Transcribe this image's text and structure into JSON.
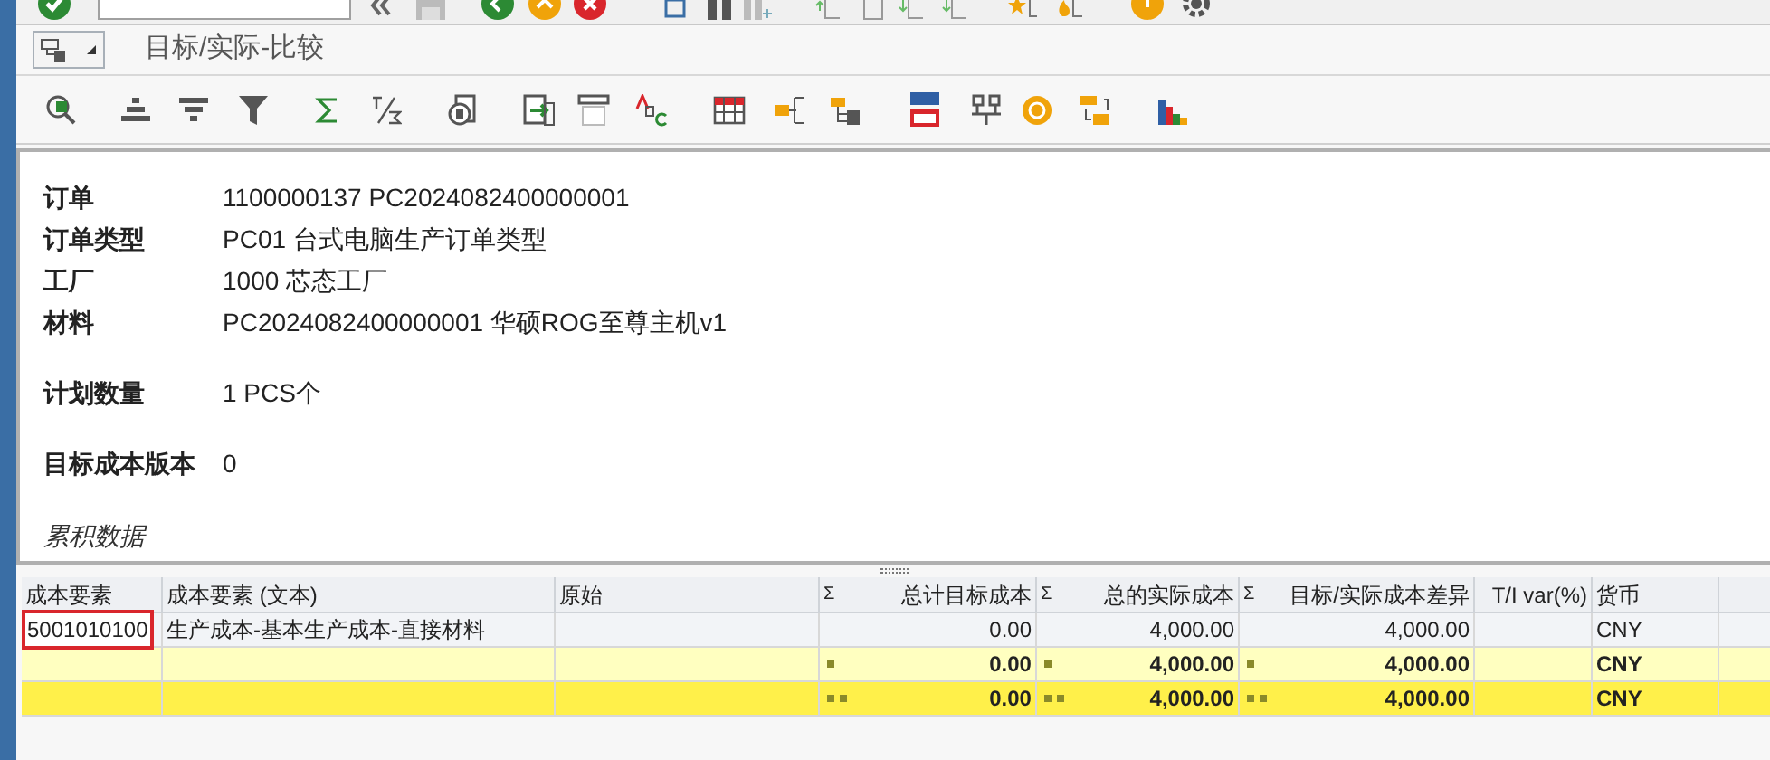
{
  "screen_title": "目标/实际-比较",
  "header_groups": [
    [
      {
        "label": "订单",
        "value": "1100000137 PC2024082400000001"
      },
      {
        "label": "订单类型",
        "value": "PC01 台式电脑生产订单类型"
      },
      {
        "label": "工厂",
        "value": "1000 芯态工厂"
      },
      {
        "label": "材料",
        "value": "PC2024082400000001 华硕ROG至尊主机v1"
      }
    ],
    [
      {
        "label": "计划数量",
        "value": "1 PCS个"
      }
    ],
    [
      {
        "label": "目标成本版本",
        "value": "0"
      }
    ]
  ],
  "section_label": "累积数据",
  "table": {
    "columns": [
      {
        "label": "成本要素",
        "kind": "text"
      },
      {
        "label": "成本要素 (文本)",
        "kind": "text"
      },
      {
        "label": "原始",
        "kind": "text"
      },
      {
        "label": "总计目标成本",
        "sum_mark": "Σ",
        "kind": "amount"
      },
      {
        "label": "总的实际成本",
        "sum_mark": "Σ",
        "kind": "amount"
      },
      {
        "label": "目标/实际成本差异",
        "sum_mark": "Σ",
        "kind": "amount"
      },
      {
        "label": "T/I var(%)",
        "kind": "amount"
      },
      {
        "label": "货币",
        "kind": "text"
      }
    ],
    "rows": [
      {
        "kind": "item",
        "focused": true,
        "cells": [
          "5001010100",
          "生产成本-基本生产成本-直接材料",
          null,
          "0.00",
          "4,000.00",
          "4,000.00",
          null,
          "CNY"
        ]
      },
      {
        "kind": "subtotal",
        "focused": false,
        "cells": [
          null,
          null,
          null,
          "0.00",
          "4,000.00",
          "4,000.00",
          null,
          "CNY"
        ]
      },
      {
        "kind": "total",
        "focused": false,
        "cells": [
          null,
          null,
          null,
          "0.00",
          "4,000.00",
          "4,000.00",
          null,
          "CNY"
        ]
      }
    ]
  }
}
